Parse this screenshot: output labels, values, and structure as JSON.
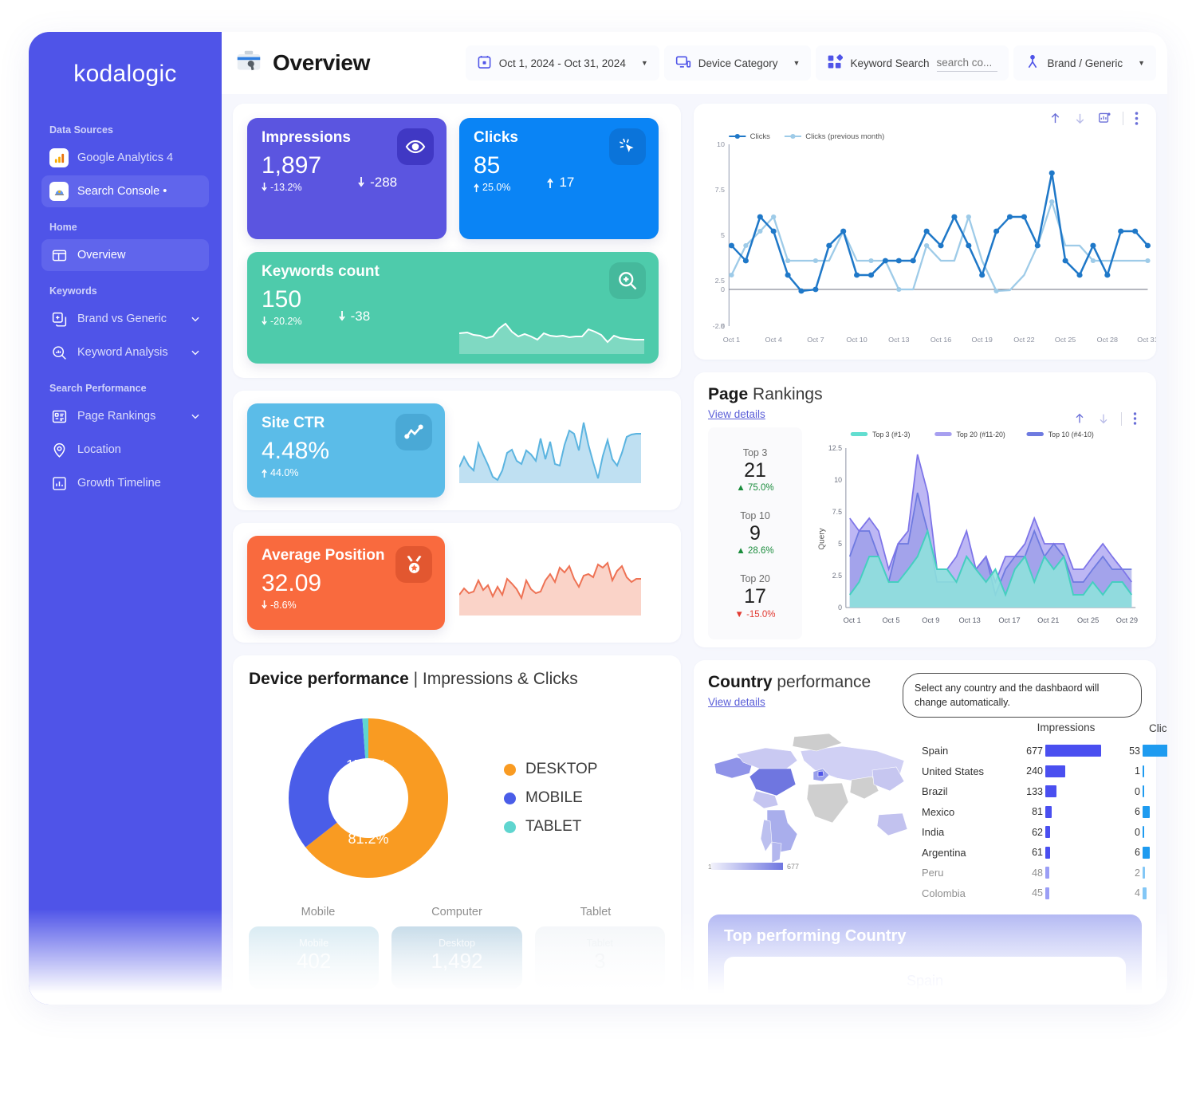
{
  "brand": {
    "name": "kodalogic",
    "accent": "#4f54e8"
  },
  "sidebar": {
    "sections": [
      {
        "heading": "Data Sources",
        "items": [
          {
            "label": "Google Analytics 4",
            "icon": "ga4-icon",
            "active": false
          },
          {
            "label": "Search Console •",
            "icon": "search-console-icon",
            "active": true
          }
        ]
      },
      {
        "heading": "Home",
        "items": [
          {
            "label": "Overview",
            "icon": "overview-icon",
            "active": true
          }
        ]
      },
      {
        "heading": "Keywords",
        "items": [
          {
            "label": "Brand vs Generic",
            "icon": "brand-generic-icon",
            "chevron": true
          },
          {
            "label": "Keyword Analysis",
            "icon": "keyword-analysis-icon",
            "chevron": true
          }
        ]
      },
      {
        "heading": "Search Performance",
        "items": [
          {
            "label": "Page Rankings",
            "icon": "page-rankings-icon",
            "chevron": true
          },
          {
            "label": "Location",
            "icon": "location-pin-icon"
          },
          {
            "label": "Growth Timeline",
            "icon": "growth-timeline-icon"
          }
        ]
      }
    ]
  },
  "header": {
    "title": "Overview",
    "filters": {
      "date_range": "Oct 1, 2024 - Oct 31, 2024",
      "device_category": "Device Category",
      "keyword_search_label": "Keyword Search",
      "keyword_search_value": "search co...",
      "keyword_search_placeholder": "search co...",
      "brand_generic": "Brand / Generic"
    }
  },
  "kpis": [
    {
      "title": "Impressions",
      "value": "1,897",
      "delta_pct": "-13.2%",
      "delta_abs": "-288",
      "dir": "down",
      "icon": "eye-icon",
      "color": "#5b55e0"
    },
    {
      "title": "Clicks",
      "value": "85",
      "delta_pct": "25.0%",
      "delta_abs": "17",
      "dir": "up",
      "icon": "click-cursor-icon",
      "color": "#0a84f5"
    },
    {
      "title": "Keywords count",
      "value": "150",
      "delta_pct": "-20.2%",
      "delta_abs": "-38",
      "dir": "down",
      "icon": "magnify-plus-icon",
      "color": "#4ecbab"
    },
    {
      "title": "Site CTR",
      "value": "4.48%",
      "delta_pct": "44.0%",
      "delta_abs": "",
      "dir": "up",
      "icon": "trendline-icon",
      "color": "#5bbce8"
    },
    {
      "title": "Average Position",
      "value": "32.09",
      "delta_pct": "-8.6%",
      "delta_abs": "",
      "dir": "down",
      "icon": "medal-icon",
      "color": "#f96a3e"
    }
  ],
  "chart_data": [
    {
      "type": "line",
      "title": "Clicks",
      "xlabel": "",
      "ylabel": "",
      "x": [
        "Oct 1",
        "Oct 2",
        "Oct 3",
        "Oct 4",
        "Oct 5",
        "Oct 6",
        "Oct 7",
        "Oct 8",
        "Oct 9",
        "Oct 10",
        "Oct 11",
        "Oct 12",
        "Oct 13",
        "Oct 14",
        "Oct 15",
        "Oct 16",
        "Oct 17",
        "Oct 18",
        "Oct 19",
        "Oct 20",
        "Oct 21",
        "Oct 22",
        "Oct 23",
        "Oct 24",
        "Oct 25",
        "Oct 26",
        "Oct 27",
        "Oct 28",
        "Oct 29",
        "Oct 30",
        "Oct 31"
      ],
      "tick_labels": [
        "Oct 1",
        "Oct 4",
        "Oct 7",
        "Oct 10",
        "Oct 13",
        "Oct 16",
        "Oct 19",
        "Oct 22",
        "Oct 25",
        "Oct 28",
        "Oct 31"
      ],
      "ylim": [
        -2.5,
        10
      ],
      "yticks": [
        -2.5,
        0,
        2.5,
        5,
        7.5,
        10
      ],
      "grid": false,
      "legend_position": "top-left",
      "series": [
        {
          "name": "Clicks",
          "color": "#1f78c8",
          "values": [
            3,
            2,
            5,
            4,
            1,
            0,
            0,
            3,
            4,
            1,
            1,
            2,
            2,
            2,
            4,
            3,
            5,
            3,
            1,
            4,
            5,
            5,
            3,
            8,
            2,
            1,
            3,
            1,
            4,
            3,
            3
          ]
        },
        {
          "name": "Clicks (previous month)",
          "color": "#9ecbe8",
          "values": [
            1,
            3,
            4,
            5,
            2,
            2,
            2,
            2,
            4,
            2,
            2,
            2,
            0,
            0,
            3,
            2,
            2,
            5,
            2,
            0,
            0,
            1,
            1,
            3,
            6,
            3,
            3,
            2,
            2,
            2,
            2
          ]
        }
      ]
    },
    {
      "type": "area",
      "title": "Page Rankings",
      "xlabel": "",
      "ylabel": "Query",
      "x": [
        "Oct 1",
        "Oct 2",
        "Oct 3",
        "Oct 4",
        "Oct 5",
        "Oct 6",
        "Oct 7",
        "Oct 8",
        "Oct 9",
        "Oct 10",
        "Oct 11",
        "Oct 12",
        "Oct 13",
        "Oct 14",
        "Oct 15",
        "Oct 16",
        "Oct 17",
        "Oct 18",
        "Oct 19",
        "Oct 20",
        "Oct 21",
        "Oct 22",
        "Oct 23",
        "Oct 24",
        "Oct 25",
        "Oct 26",
        "Oct 27",
        "Oct 28",
        "Oct 29",
        "Oct 30"
      ],
      "tick_labels": [
        "Oct 1",
        "Oct 5",
        "Oct 9",
        "Oct 13",
        "Oct 17",
        "Oct 21",
        "Oct 25",
        "Oct 29"
      ],
      "ylim": [
        0,
        12.5
      ],
      "yticks": [
        0,
        2.5,
        5,
        7.5,
        10,
        12.5
      ],
      "grid": false,
      "legend_position": "top",
      "series": [
        {
          "name": "Top 3 (#1-3)",
          "color": "#62ded0",
          "values": [
            1,
            2,
            4,
            4,
            2,
            2,
            3,
            4,
            6,
            3,
            3,
            2,
            4,
            3,
            2,
            3,
            1,
            3,
            4,
            2,
            4,
            3,
            4,
            1,
            1,
            2,
            1,
            2,
            2,
            1
          ]
        },
        {
          "name": "Top 20 (#11-20)",
          "color": "#a79ff0",
          "values": [
            7,
            6,
            7,
            6,
            3,
            5,
            6,
            12,
            9,
            3,
            3,
            4,
            6,
            3,
            4,
            2,
            4,
            4,
            5,
            7,
            5,
            5,
            5,
            3,
            3,
            4,
            5,
            4,
            3,
            2
          ]
        },
        {
          "name": "Top 10 (#4-10)",
          "color": "#6e7ae0",
          "values": [
            4,
            6,
            6,
            4,
            2,
            5,
            5,
            9,
            6,
            2,
            2,
            2,
            4,
            3,
            4,
            1,
            3,
            4,
            4,
            6,
            4,
            5,
            4,
            2,
            2,
            3,
            4,
            3,
            3,
            3
          ]
        }
      ]
    },
    {
      "type": "pie",
      "title": "Device performance",
      "subtitle": "Impressions & Clicks",
      "labels": [
        "DESKTOP",
        "MOBILE",
        "TABLET"
      ],
      "values": [
        81.2,
        17.6,
        1.2
      ],
      "display_labels": [
        "81.2%",
        "17.6%",
        ""
      ],
      "colors": [
        "#f99b22",
        "#4a5de8",
        "#5fd5cf"
      ],
      "legend_position": "right"
    },
    {
      "type": "table",
      "title": "Country performance",
      "columns": [
        "",
        "Impressions",
        "Clicks"
      ],
      "rows": [
        {
          "country": "Spain",
          "impressions": "677",
          "clicks": "53",
          "imp_w": 100,
          "clk_w": 100
        },
        {
          "country": "United States",
          "impressions": "240",
          "clicks": "1",
          "imp_w": 35,
          "clk_w": 2
        },
        {
          "country": "Brazil",
          "impressions": "133",
          "clicks": "0",
          "imp_w": 20,
          "clk_w": 1
        },
        {
          "country": "Mexico",
          "impressions": "81",
          "clicks": "6",
          "imp_w": 12,
          "clk_w": 11
        },
        {
          "country": "India",
          "impressions": "62",
          "clicks": "0",
          "imp_w": 9,
          "clk_w": 1
        },
        {
          "country": "Argentina",
          "impressions": "61",
          "clicks": "6",
          "imp_w": 9,
          "clk_w": 11
        },
        {
          "country": "Peru",
          "impressions": "48",
          "clicks": "2",
          "imp_w": 7,
          "clk_w": 4
        },
        {
          "country": "Colombia",
          "impressions": "45",
          "clicks": "4",
          "imp_w": 7,
          "clk_w": 7
        }
      ],
      "map_legend_max": "677",
      "map_legend_min": "1"
    }
  ],
  "clicks_panel": {
    "legend": [
      "Clicks",
      "Clicks (previous month)"
    ]
  },
  "rankings": {
    "title_bold": "Page",
    "title_rest": " Rankings",
    "view_details": "View details",
    "kpis": [
      {
        "label": "Top 3",
        "value": "21",
        "change": "75.0%",
        "dir": "up"
      },
      {
        "label": "Top 10",
        "value": "9",
        "change": "28.6%",
        "dir": "up"
      },
      {
        "label": "Top 20",
        "value": "17",
        "change": "-15.0%",
        "dir": "down"
      }
    ],
    "y_axis_label": "Query"
  },
  "device": {
    "title_bold": "Device performance",
    "title_rest": " | Impressions & Clicks",
    "column_labels": [
      "Mobile",
      "Computer",
      "Tablet"
    ],
    "cards": [
      {
        "name": "Mobile",
        "value": "402"
      },
      {
        "name": "Desktop",
        "value": "1,492"
      },
      {
        "name": "Tablet",
        "value": "3"
      }
    ]
  },
  "country": {
    "title_bold": "Country",
    "title_rest": " performance",
    "view_details": "View details",
    "tooltip": "Select any country and the dashbaord will change automatically."
  },
  "top_country": {
    "title": "Top performing Country",
    "value": "Spain"
  }
}
